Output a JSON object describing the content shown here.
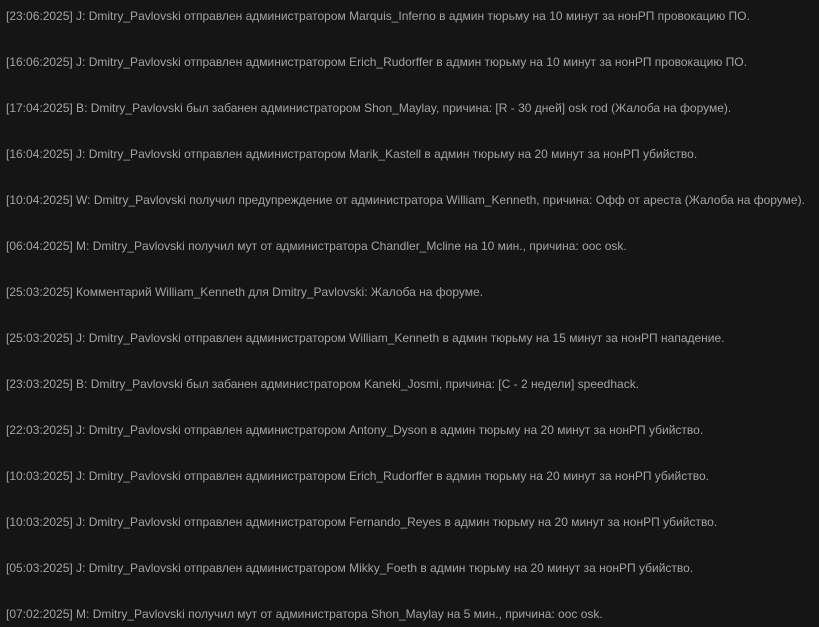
{
  "log": {
    "entries": [
      "[23:06:2025] J: Dmitry_Pavlovski отправлен администратором Marquis_Inferno в админ тюрьму на 10 минут за нонРП провокацию ПО.",
      "[16:06:2025] J: Dmitry_Pavlovski отправлен администратором Erich_Rudorffer в админ тюрьму на 10 минут за нонРП провокацию ПО.",
      "[17:04:2025] B: Dmitry_Pavlovski был забанен администратором Shon_Maylay, причина: [R - 30 дней] osk rod (Жалоба на форуме).",
      "[16:04:2025] J: Dmitry_Pavlovski отправлен администратором Marik_Kastell в админ тюрьму на 20 минут за нонРП убийство.",
      "[10:04:2025] W: Dmitry_Pavlovski получил предупреждение от администратора William_Kenneth, причина: Офф от ареста (Жалоба на форуме).",
      "[06:04:2025] M: Dmitry_Pavlovski получил мут от администратора Chandler_Mcline на 10 мин., причина: оос osk.",
      "[25:03:2025] Комментарий William_Kenneth для Dmitry_Pavlovski: Жалоба на форуме.",
      "[25:03:2025] J: Dmitry_Pavlovski отправлен администратором William_Kenneth в админ тюрьму на 15 минут за нонРП нападение.",
      "[23:03:2025] B: Dmitry_Pavlovski был забанен администратором Kaneki_Josmi, причина: [C - 2 недели] speedhack.",
      "[22:03:2025] J: Dmitry_Pavlovski отправлен администратором Antony_Dyson в админ тюрьму на 20 минут за нонРП убийство.",
      "[10:03:2025] J: Dmitry_Pavlovski отправлен администратором Erich_Rudorffer в админ тюрьму на 20 минут за нонРП убийство.",
      "[10:03:2025] J: Dmitry_Pavlovski отправлен администратором Fernando_Reyes в админ тюрьму на 20 минут за нонРП убийство.",
      "[05:03:2025] J: Dmitry_Pavlovski отправлен администратором Mikky_Foeth в админ тюрьму на 20 минут за нонРП убийство.",
      "[07:02:2025] M: Dmitry_Pavlovski получил мут от администратора Shon_Maylay на 5 мин., причина: оос osk."
    ]
  }
}
